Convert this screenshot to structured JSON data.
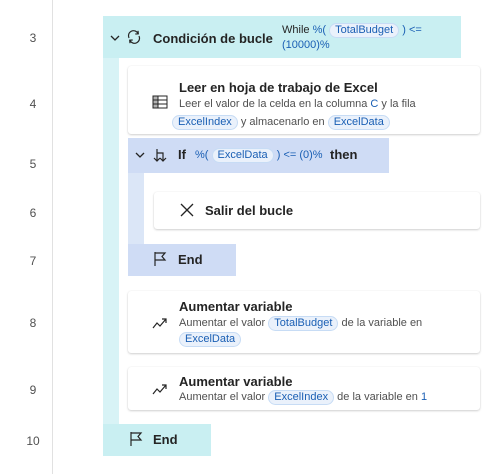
{
  "line_numbers": [
    "3",
    "4",
    "5",
    "6",
    "7",
    "8",
    "9",
    "10"
  ],
  "loop": {
    "title": "Condición de bucle",
    "cond_prefix": "While",
    "cond_open": "%(",
    "variable": "TotalBudget",
    "cond_op": ") <=",
    "cond_value": "(10000)%"
  },
  "read_excel": {
    "title": "Leer en hoja de trabajo de Excel",
    "desc_part1": "Leer el valor de la celda en la columna",
    "column": "C",
    "desc_part2": "y la fila",
    "row_var": "ExcelIndex",
    "desc_part3": "y almacenarlo en",
    "store_var": "ExcelData"
  },
  "if_block": {
    "keyword": "If",
    "cond_open": "%(",
    "variable": "ExcelData",
    "cond_rest": ") <= (0)%",
    "then": "then"
  },
  "exit_loop": {
    "title": "Salir del bucle"
  },
  "end_if": {
    "label": "End"
  },
  "increase1": {
    "title": "Aumentar variable",
    "desc_part1": "Aumentar el valor",
    "value_var": "TotalBudget",
    "desc_part2": "de la variable en",
    "target_var": "ExcelData"
  },
  "increase2": {
    "title": "Aumentar variable",
    "desc_part1": "Aumentar el valor",
    "value_var": "ExcelIndex",
    "desc_part2": "de la variable en",
    "amount": "1"
  },
  "end_loop": {
    "label": "End"
  },
  "colors": {
    "loop_header": "#c9eff2",
    "loop_rail": "#d8f3f6",
    "if_header": "#cfdcf5",
    "if_rail": "#dbe6f7",
    "variable_token": "#1a5fb4"
  },
  "icons": [
    "chevron-down-icon",
    "loop-icon",
    "excel-read-icon",
    "if-branch-icon",
    "close-icon",
    "flag-icon",
    "trend-up-icon"
  ]
}
